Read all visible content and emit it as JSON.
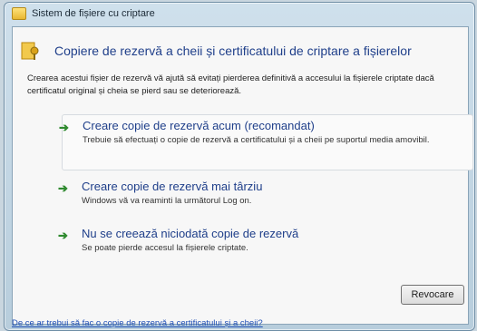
{
  "window": {
    "title": "Sistem de fișiere cu criptare"
  },
  "dialog": {
    "heading": "Copiere de rezervă a cheii și certificatului de criptare a fișierelor",
    "intro": "Crearea acestui fișier de rezervă vă ajută să evitați pierderea definitivă a accesului la fișierele criptate dacă certificatul original și cheia se pierd sau se deteriorează.",
    "options": [
      {
        "title": "Creare copie de rezervă acum (recomandat)",
        "description": "Trebuie să efectuați o copie de rezervă a certificatului și a cheii pe suportul media amovibil."
      },
      {
        "title": "Creare copie de rezervă mai târziu",
        "description": "Windows vă va reaminti la următorul Log on."
      },
      {
        "title": "Nu se creează niciodată copie de rezervă",
        "description": "Se poate pierde accesul la fișierele criptate."
      }
    ],
    "cancel_label": "Revocare",
    "help_link": "De ce ar trebui să fac o copie de rezervă a certificatului și a cheii?"
  }
}
